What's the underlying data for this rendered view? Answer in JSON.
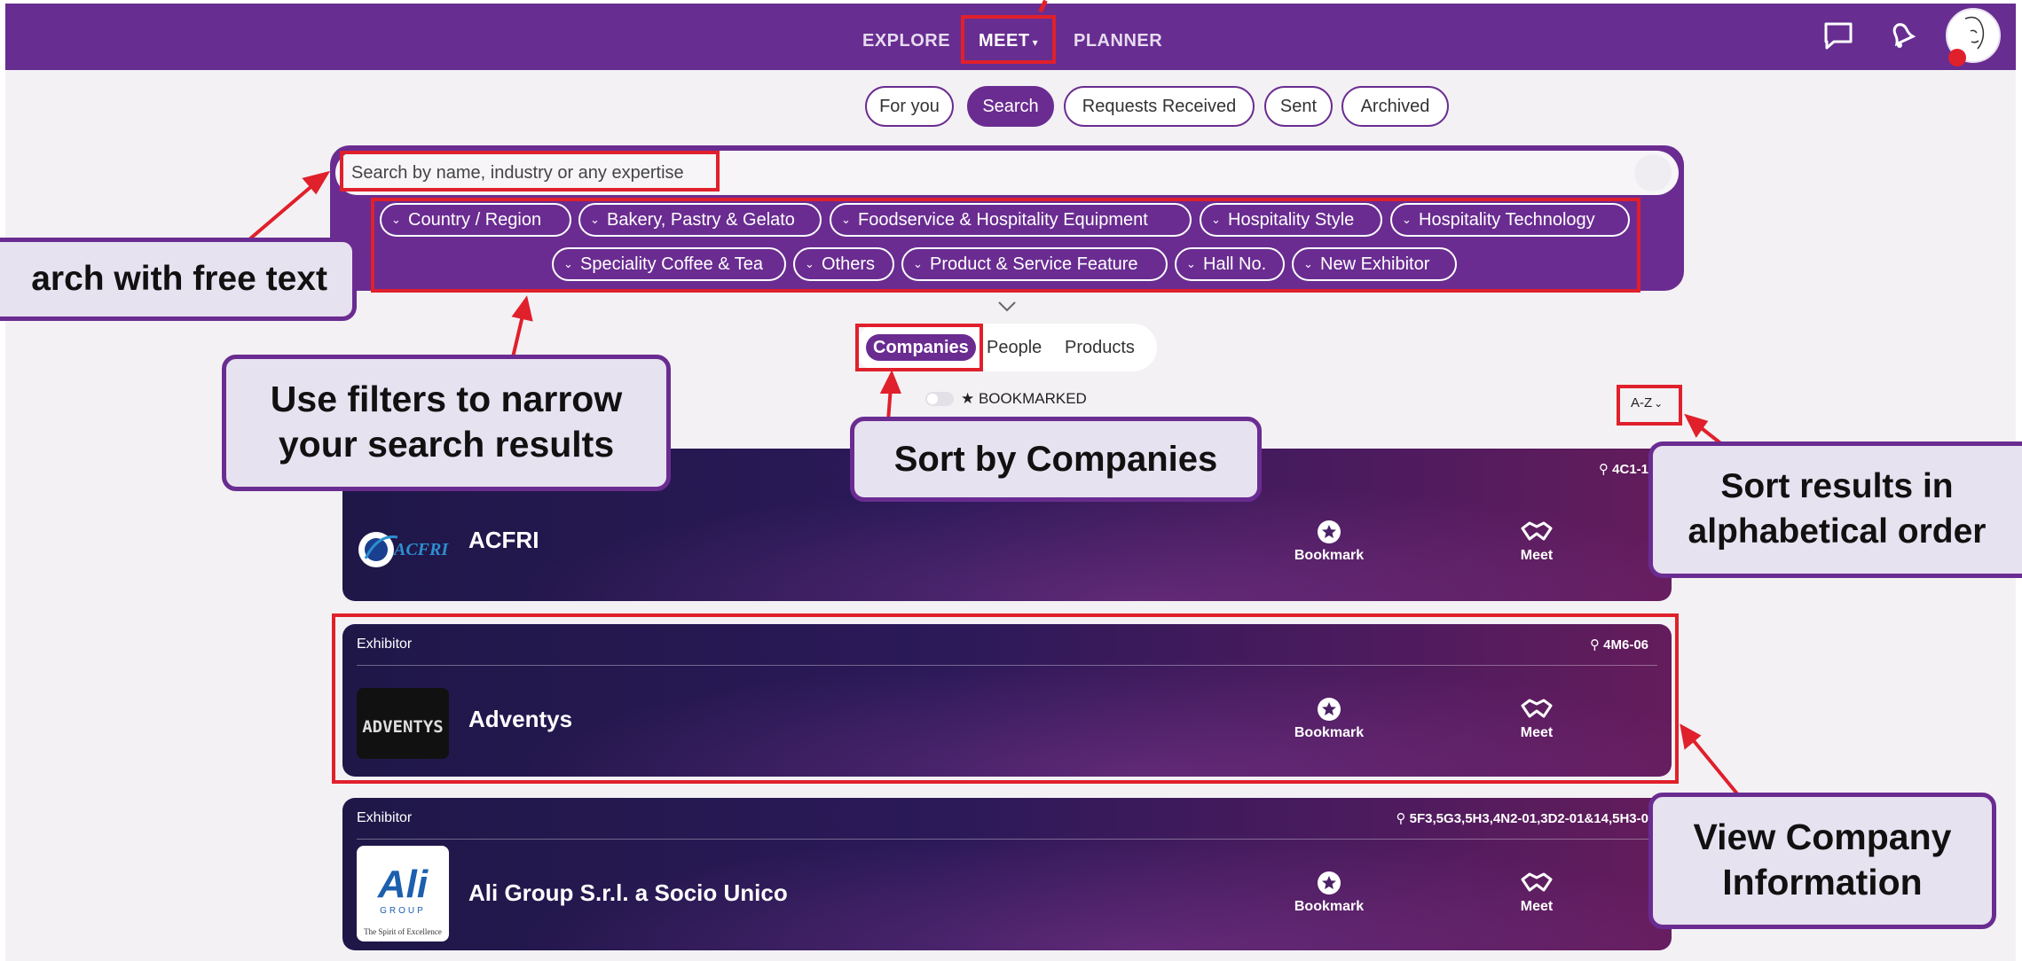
{
  "nav": {
    "items": [
      "EXPLORE",
      "MEET",
      "PLANNER"
    ],
    "meet_caret": "▾"
  },
  "meet_tabs": [
    "For you",
    "Search",
    "Requests Received",
    "Sent",
    "Archived"
  ],
  "search": {
    "placeholder": "Search by name, industry or any expertise"
  },
  "filters": [
    "Country / Region",
    "Bakery, Pastry & Gelato",
    "Foodservice & Hospitality Equipment",
    "Hospitality Style",
    "Hospitality Technology",
    "Speciality Coffee & Tea",
    "Others",
    "Product & Service Feature",
    "Hall No.",
    "New Exhibitor"
  ],
  "entity_tabs": [
    "Companies",
    "People",
    "Products"
  ],
  "bookmarked_label": "★ BOOKMARKED",
  "sort_label": "A-Z",
  "cards": [
    {
      "type": "",
      "location": "4C1-1",
      "name": "ACFRI",
      "logo_text": "ACFRI",
      "bookmark_label": "Bookmark",
      "meet_label": "Meet"
    },
    {
      "type": "Exhibitor",
      "location": "4M6-06",
      "name": "Adventys",
      "logo_text": "ADVENTYS",
      "bookmark_label": "Bookmark",
      "meet_label": "Meet"
    },
    {
      "type": "Exhibitor",
      "location": "5F3,5G3,5H3,4N2-01,3D2-01&14,5H3-0",
      "name": "Ali Group S.r.l. a Socio Unico",
      "logo_text": "Ali",
      "logo_sub1": "GROUP",
      "logo_sub2": "The Spirit of Excellence",
      "bookmark_label": "Bookmark",
      "meet_label": "Meet"
    }
  ],
  "callouts": {
    "free_text": "arch with free text",
    "filters": [
      "Use filters to narrow",
      "your search results"
    ],
    "sort_companies": "Sort by Companies",
    "sort_alpha": [
      "Sort results in",
      "alphabetical order"
    ],
    "view_company": [
      "View Company",
      "Information"
    ]
  },
  "colors": {
    "brand_purple": "#672d91",
    "highlight_red": "#e0202b",
    "callout_bg": "#e7e2f0"
  }
}
